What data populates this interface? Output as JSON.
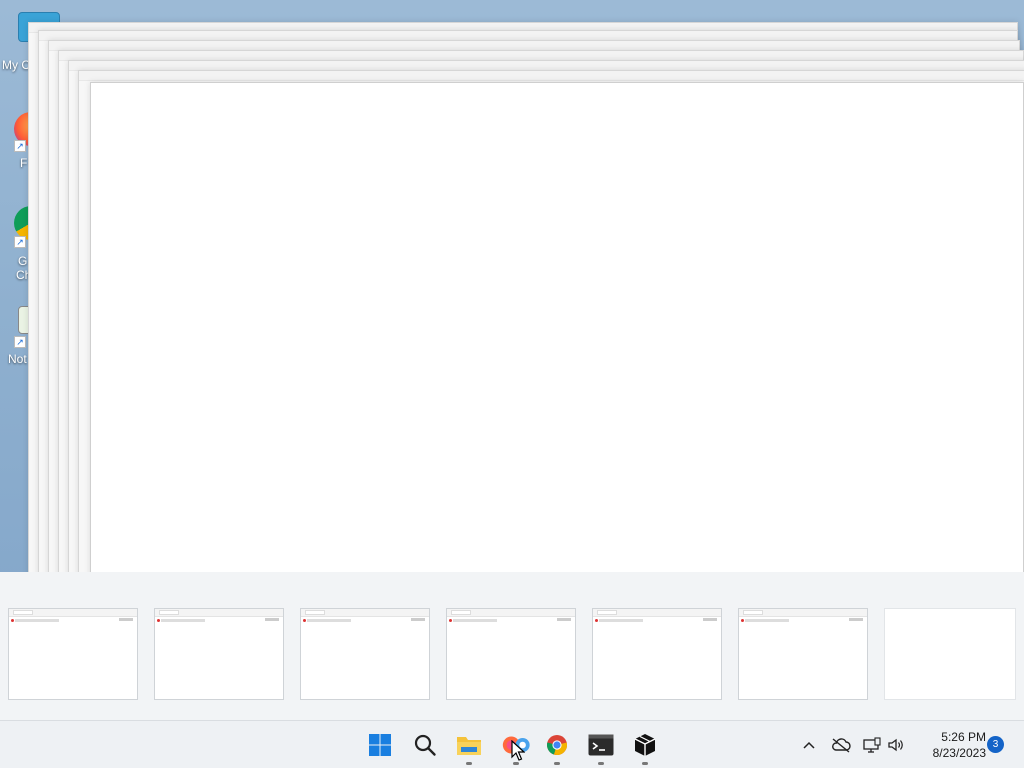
{
  "desktop": {
    "icons": [
      {
        "label": "My C"
      },
      {
        "label": "F"
      },
      {
        "label": "G"
      },
      {
        "label": "Ch"
      },
      {
        "label": "Not"
      }
    ]
  },
  "taskview": {
    "thumbnails": 7
  },
  "taskbar": {
    "apps": [
      {
        "name": "start-icon"
      },
      {
        "name": "search-icon"
      },
      {
        "name": "file-explorer-icon"
      },
      {
        "name": "firefox-icon"
      },
      {
        "name": "chrome-icon"
      },
      {
        "name": "terminal-icon"
      },
      {
        "name": "package-icon"
      }
    ],
    "tray": {
      "time": "5:26 PM",
      "date": "8/23/2023",
      "notification_count": "3"
    }
  },
  "colors": {
    "accent": "#1464c8",
    "taskbar_bg": "#eef1f4",
    "desktop_bg": "#8fb0cf"
  }
}
